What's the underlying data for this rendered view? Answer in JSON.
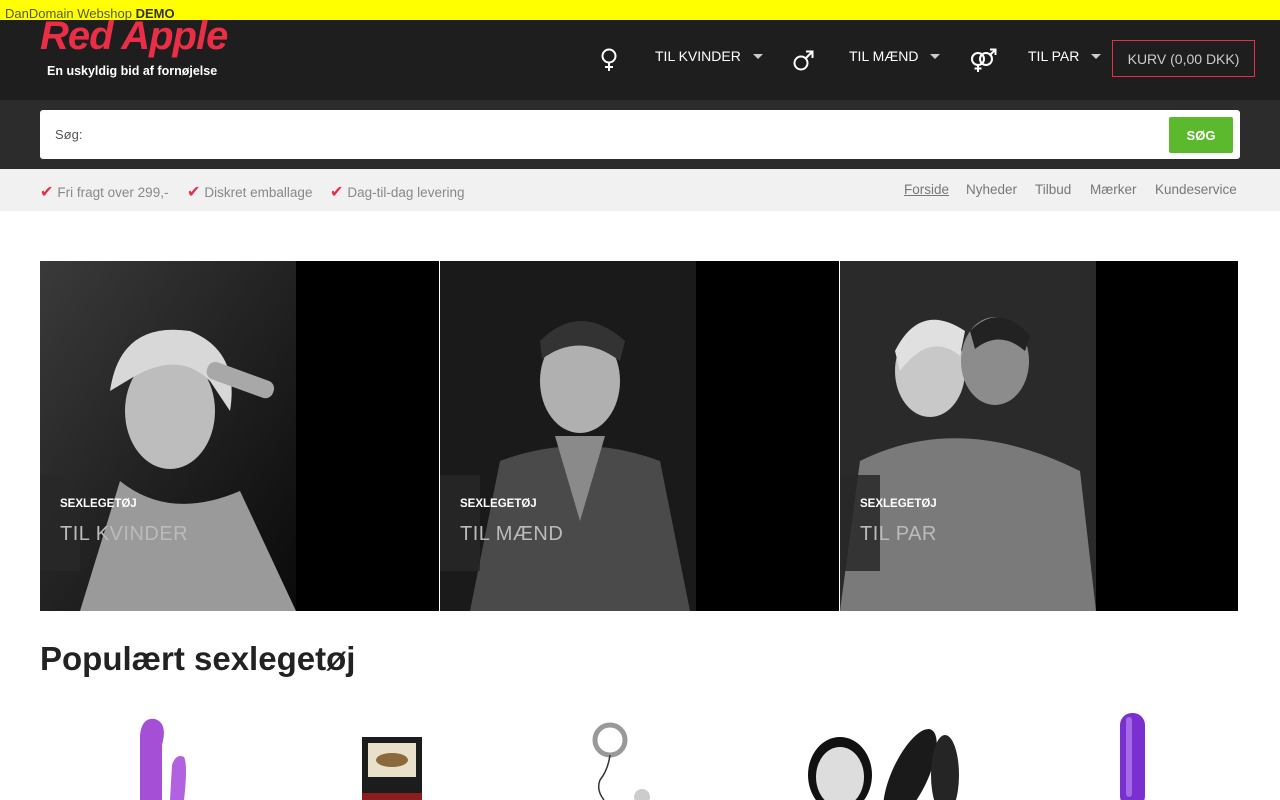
{
  "demo_bar": {
    "prefix": "DanDomain Webshop",
    "suffix": "DEMO"
  },
  "brand": {
    "name": "Red Apple",
    "tagline": "En uskyldig bid af fornøjelse",
    "accent_color": "#ea2e46"
  },
  "nav": {
    "items": [
      {
        "icon": "female-symbol-icon",
        "label": "TIL KVINDER"
      },
      {
        "icon": "male-symbol-icon",
        "label": "TIL MÆND"
      },
      {
        "icon": "couple-symbol-icon",
        "label": "TIL PAR"
      }
    ],
    "cart_label": "KURV (0,00 DKK)"
  },
  "search": {
    "label": "Søg:",
    "value": "",
    "placeholder": "",
    "button_label": "SØG",
    "button_color": "#5cb82d"
  },
  "usps": [
    {
      "icon": "check-icon",
      "text": "Fri fragt over 299,-"
    },
    {
      "icon": "check-icon",
      "text": "Diskret emballage"
    },
    {
      "icon": "check-icon",
      "text": "Dag-til-dag levering"
    }
  ],
  "top_links": [
    "Forside",
    "Nyheder",
    "Tilbud",
    "Mærker",
    "Kundeservice"
  ],
  "active_top_link": "Forside",
  "banners": [
    {
      "small": "SEXLEGETØJ",
      "big": "TIL KVINDER"
    },
    {
      "small": "SEXLEGETØJ",
      "big": "TIL MÆND"
    },
    {
      "small": "SEXLEGETØJ",
      "big": "TIL PAR"
    }
  ],
  "popular": {
    "title": "Populært sexlegetøj"
  }
}
